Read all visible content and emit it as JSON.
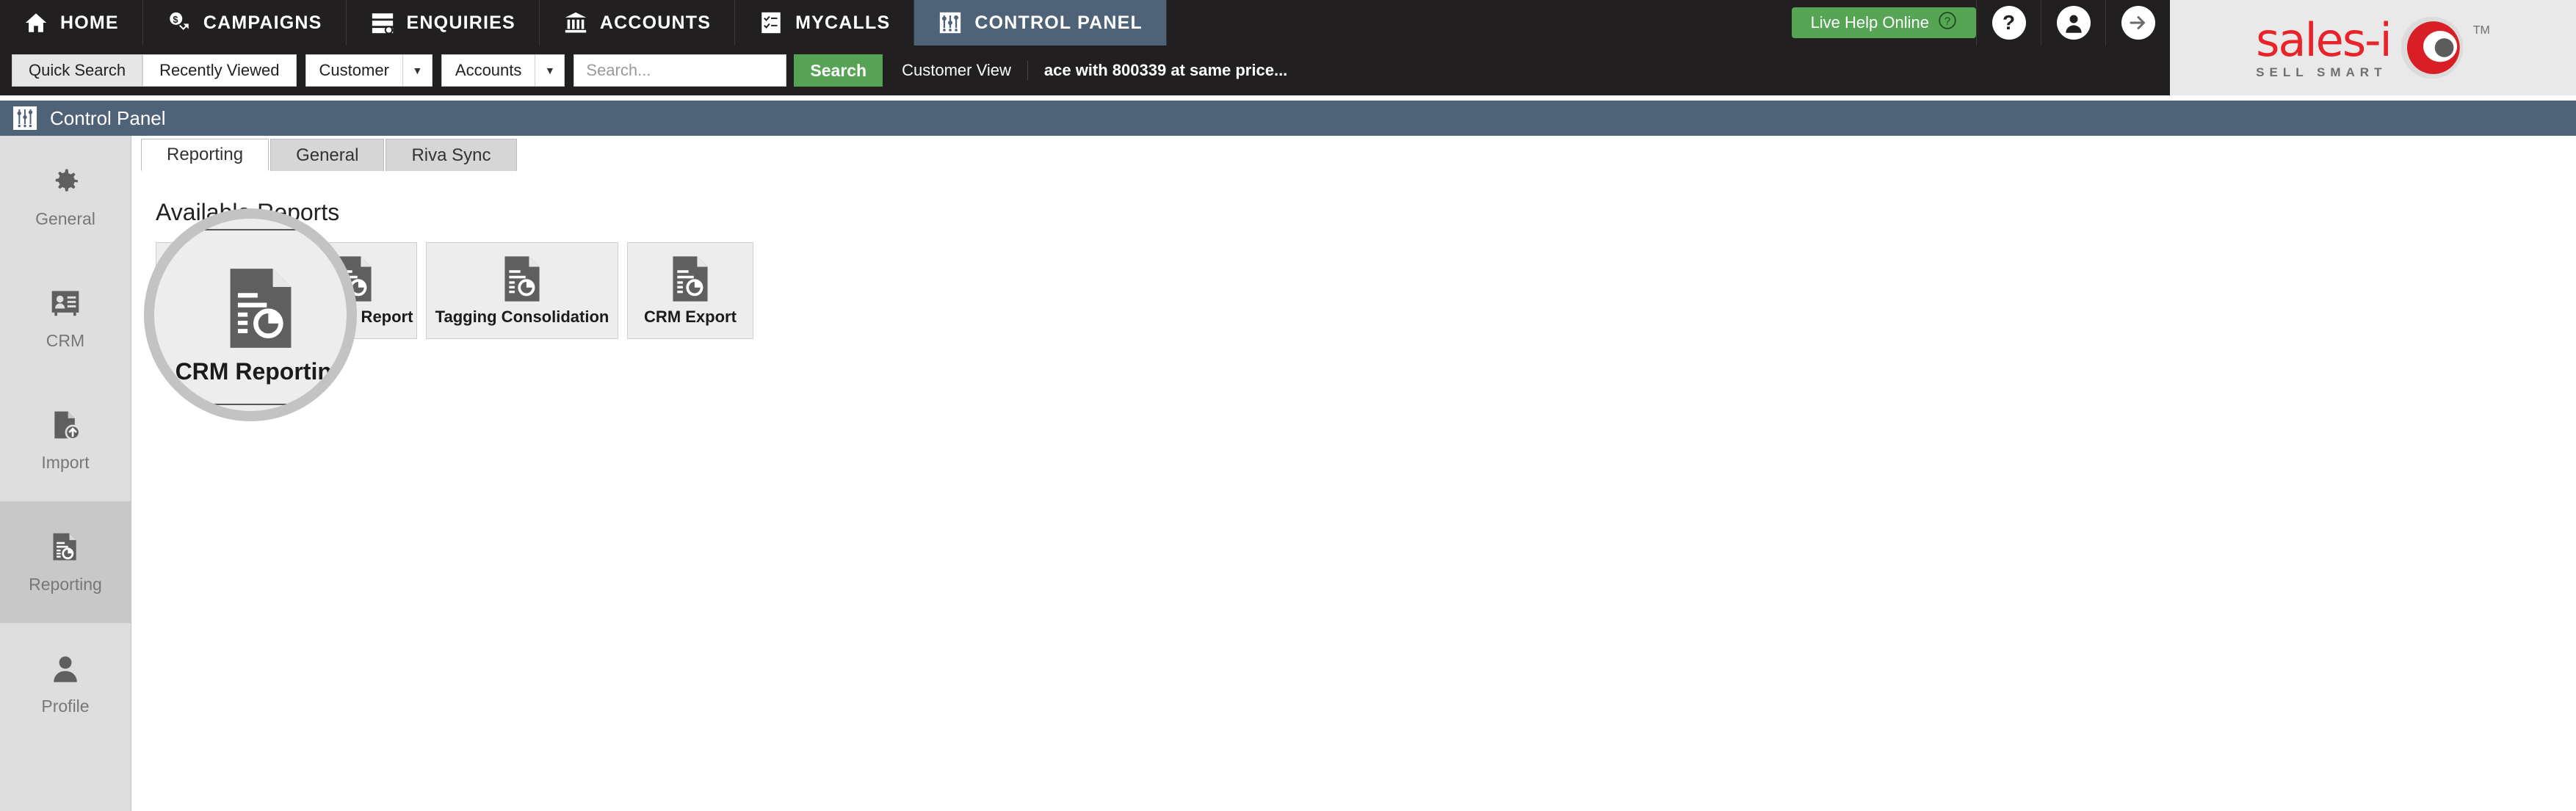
{
  "topnav": {
    "items": [
      {
        "label": "HOME",
        "icon": "home-icon",
        "active": false
      },
      {
        "label": "CAMPAIGNS",
        "icon": "campaigns-icon",
        "active": false
      },
      {
        "label": "ENQUIRIES",
        "icon": "enquiries-icon",
        "active": false
      },
      {
        "label": "ACCOUNTS",
        "icon": "accounts-icon",
        "active": false
      },
      {
        "label": "MYCALLS",
        "icon": "mycalls-icon",
        "active": false
      },
      {
        "label": "CONTROL PANEL",
        "icon": "control-panel-icon",
        "active": true
      }
    ],
    "live_help_label": "Live Help Online",
    "help_icon": "question-mark-icon",
    "profile_icon": "user-avatar-icon",
    "logout_icon": "arrow-right-icon",
    "accent_green": "#55a555",
    "active_tab_color": "#4e6278",
    "bar_color": "#211f1f"
  },
  "logo": {
    "main": "sales-i",
    "tagline": "SELL SMART",
    "trademark": "TM",
    "brand_red": "#e8232a",
    "panel_bg": "#e9e9e9"
  },
  "search": {
    "quick_search_label": "Quick Search",
    "recently_viewed_label": "Recently Viewed",
    "customer_select": "Customer",
    "accounts_select": "Accounts",
    "placeholder": "Search...",
    "search_button": "Search",
    "customer_view_label": "Customer View",
    "ticker_text": "ace with 800339 at same price...",
    "search_button_color": "#56a356"
  },
  "control_panel_header": {
    "title": "Control Panel",
    "icon": "sliders-icon",
    "bg": "#4e6278"
  },
  "sidebar": {
    "items": [
      {
        "label": "General",
        "icon": "gear-icon",
        "active": false
      },
      {
        "label": "CRM",
        "icon": "contacts-icon",
        "active": false
      },
      {
        "label": "Import",
        "icon": "import-icon",
        "active": false
      },
      {
        "label": "Reporting",
        "icon": "report-icon",
        "active": true
      },
      {
        "label": "Profile",
        "icon": "person-icon",
        "active": false
      }
    ]
  },
  "main": {
    "tabs": [
      {
        "label": "Reporting",
        "active": true
      },
      {
        "label": "General",
        "active": false
      },
      {
        "label": "Riva Sync",
        "active": false
      }
    ],
    "section_title": "Available Reports",
    "tiles": [
      {
        "label": "CRM Reporting",
        "icon": "report-doc-icon",
        "wide": false
      },
      {
        "label": "Tagging Report",
        "icon": "report-doc-icon",
        "wide": false
      },
      {
        "label": "Tagging Consolidation",
        "icon": "report-doc-icon",
        "wide": true
      },
      {
        "label": "CRM Export",
        "icon": "report-doc-icon",
        "wide": false
      }
    ]
  },
  "magnifier": {
    "target_label": "CRM Reporting",
    "target_icon": "report-doc-icon",
    "ring_color": "#b4b4b4"
  }
}
